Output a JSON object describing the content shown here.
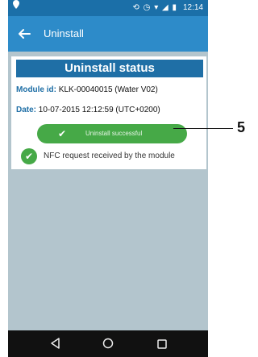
{
  "status_bar": {
    "time": "12:14"
  },
  "app_bar": {
    "title": "Uninstall"
  },
  "card": {
    "header": "Uninstall status",
    "module_label": "Module id:",
    "module_value": "KLK-00040015 (Water V02)",
    "date_label": "Date:",
    "date_value": "10-07-2015 12:12:59 (UTC+0200)",
    "success_text": "Uninstall successful",
    "nfc_text": "NFC request received by the module"
  },
  "callout": {
    "number": "5"
  },
  "icons": {
    "back": "arrow-left-icon",
    "success": "check-icon",
    "nfc": "check-circle-icon",
    "nav_back": "triangle-back-icon",
    "nav_home": "circle-home-icon",
    "nav_recent": "square-recent-icon"
  },
  "colors": {
    "status_bar": "#1b6fa8",
    "app_bar": "#2d8bc9",
    "card_header": "#1f6fa6",
    "success": "#46a947",
    "background": "#b3c5cd"
  }
}
